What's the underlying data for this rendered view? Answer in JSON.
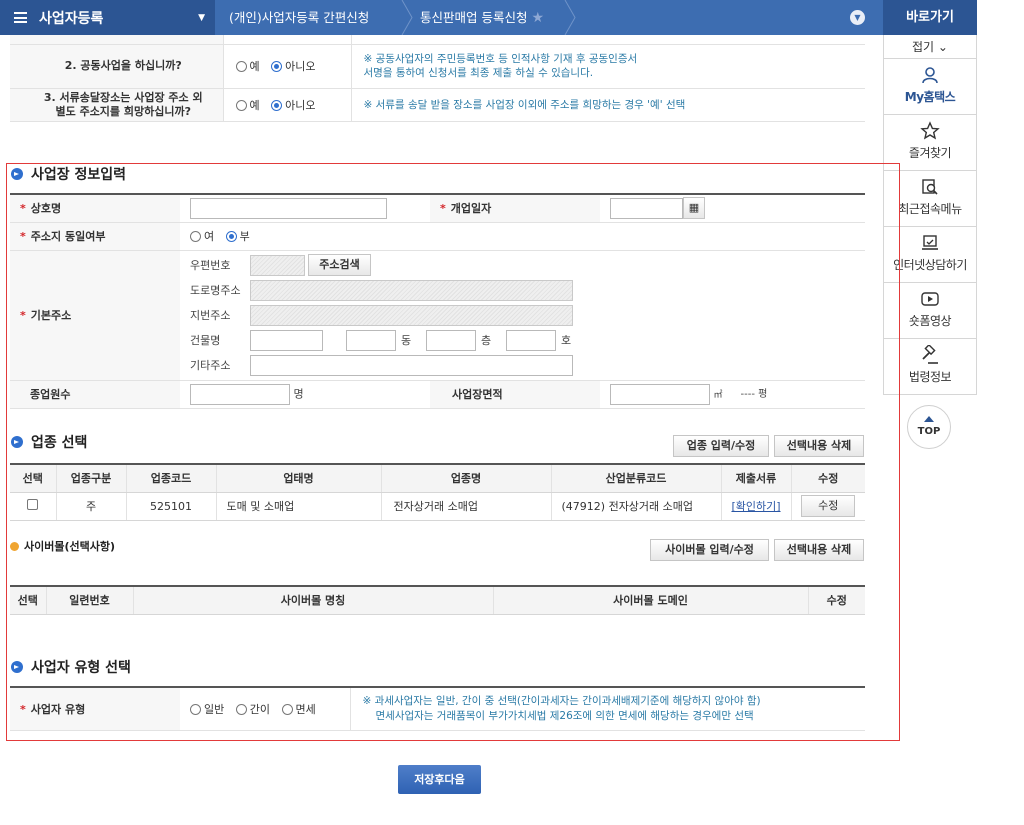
{
  "topbar": {
    "menu_title": "사업자등록",
    "crumb1": "(개인)사업자등록 간편신청",
    "crumb2": "통신판매업 등록신청"
  },
  "quick": {
    "title": "바로가기",
    "fold": "접기",
    "items": [
      {
        "label": "My홈택스",
        "icon": "user-icon"
      },
      {
        "label": "즐겨찾기",
        "icon": "star-icon"
      },
      {
        "label": "최근접속메뉴",
        "icon": "recent-search-icon"
      },
      {
        "label": "인터넷상담하기",
        "icon": "laptop-chat-icon"
      },
      {
        "label": "숏폼영상",
        "icon": "play-icon"
      },
      {
        "label": "법령정보",
        "icon": "gavel-icon"
      }
    ],
    "top": "TOP"
  },
  "questions": [
    {
      "label": "2. 공동사업을 하십니까?",
      "yes": "예",
      "no": "아니오",
      "selected": "no",
      "note": "※ 공동사업자의 주민등록번호 등 인적사항 기재 후 공동인증서\n    서명을 통하여 신청서를 최종 제출 하실 수 있습니다."
    },
    {
      "label": "3. 서류송달장소는 사업장 주소 외\n별도 주소지를 희망하십니까?",
      "yes": "예",
      "no": "아니오",
      "selected": "no",
      "note": "※ 서류를 송달 받을 장소를 사업장 이외에 주소를 희망하는 경우 '예' 선택"
    }
  ],
  "business_info": {
    "title": "사업장 정보입력",
    "trade_name_label": "상호명",
    "open_date_label": "개업일자",
    "same_address_label": "주소지 동일여부",
    "same_yes": "여",
    "same_no": "부",
    "same_selected": "no",
    "address_label": "기본주소",
    "postal_label": "우편번호",
    "address_search": "주소검색",
    "road_label": "도로명주소",
    "lot_label": "지번주소",
    "building_label": "건물명",
    "dong": "동",
    "floor": "층",
    "ho": "호",
    "etc_label": "기타주소",
    "employees_label": "종업원수",
    "employees_unit": "명",
    "area_label": "사업장면적",
    "area_unit": "㎡",
    "pyeong": "---- 평"
  },
  "industry": {
    "title": "업종 선택",
    "btn_edit": "업종 입력/수정",
    "btn_delete": "선택내용 삭제",
    "columns": [
      "선택",
      "업종구분",
      "업종코드",
      "업태명",
      "업종명",
      "산업분류코드",
      "제출서류",
      "수정"
    ],
    "rows": [
      {
        "type": "주",
        "code": "525101",
        "biz_type": "도매 및 소매업",
        "item": "전자상거래 소매업",
        "ksic": "(47912) 전자상거래 소매업",
        "docs": "[확인하기]",
        "edit": "수정"
      }
    ]
  },
  "cybermall": {
    "title": "사이버몰(선택사항)",
    "btn_edit": "사이버몰 입력/수정",
    "btn_delete": "선택내용 삭제",
    "columns": [
      "선택",
      "일련번호",
      "사이버몰 명칭",
      "사이버몰 도메인",
      "수정"
    ]
  },
  "biz_type": {
    "title": "사업자 유형 선택",
    "label": "사업자 유형",
    "options": [
      "일반",
      "간이",
      "면세"
    ],
    "note1": "※ 과세사업자는 일반, 간이 중 선택(간이과세자는 간이과세배제기준에 해당하지 않아야 함)",
    "note2": "면세사업자는 거래품목이 부가가치세법 제26조에 의한 면세에 해당하는 경우에만 선택"
  },
  "save_button": "저장후다음"
}
